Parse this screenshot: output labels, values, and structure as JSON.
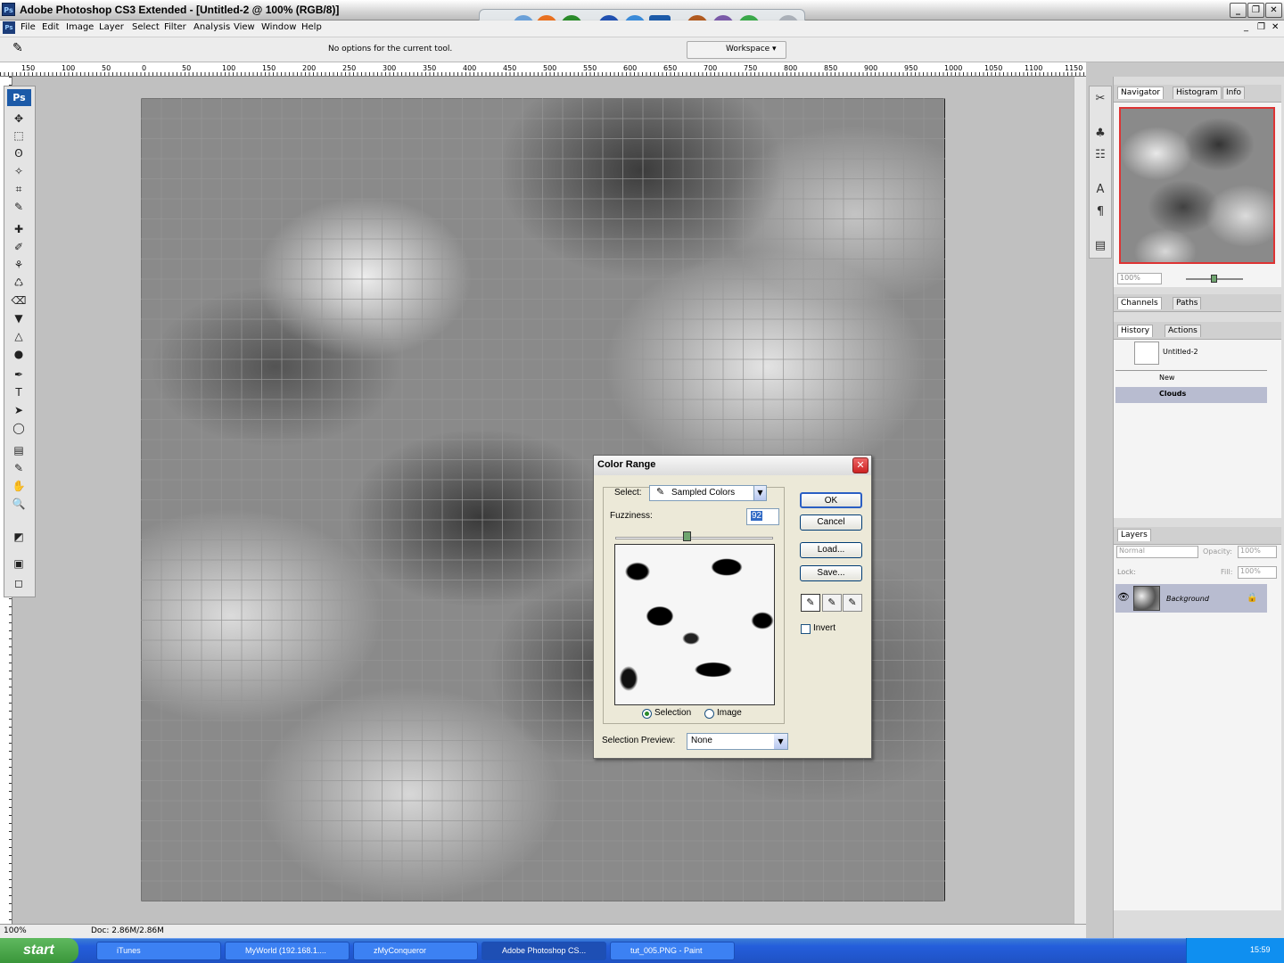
{
  "window": {
    "app_icon": "Ps",
    "title": "Adobe Photoshop CS3 Extended - [Untitled-2 @ 100% (RGB/8)]",
    "controls": [
      "_",
      "❐",
      "✕"
    ]
  },
  "quick_launch": {
    "icons": [
      "E",
      "E",
      "❖",
      "◉",
      "✚",
      "◎",
      "♫",
      "Ps",
      "CTV",
      "▦",
      "◆",
      "⟲"
    ]
  },
  "menu": {
    "app_icon": "Ps",
    "items": [
      "File",
      "Edit",
      "Image",
      "Layer",
      "Select",
      "Filter",
      "Analysis",
      "View",
      "Window",
      "Help"
    ],
    "doc_controls": [
      "_",
      "❐",
      "✕"
    ]
  },
  "options_bar": {
    "tool_icon": "✎",
    "message": "No options for the current tool.",
    "workspace_label": "Workspace ▾"
  },
  "ruler": {
    "top_labels": [
      "150",
      "100",
      "50",
      "0",
      "50",
      "100",
      "150",
      "200",
      "250",
      "300",
      "350",
      "400",
      "450",
      "500",
      "550",
      "600",
      "650",
      "700",
      "750",
      "800",
      "850",
      "900",
      "950",
      "1000",
      "1050",
      "1100",
      "1150"
    ]
  },
  "toolbox": {
    "logo": "Ps",
    "tools": [
      "✥",
      "⬚",
      "ʘ",
      "✧",
      "⌗",
      "✎",
      "✚",
      "✐",
      "⚘",
      "♺",
      "⌫",
      "▼",
      "△",
      "●",
      "✒",
      "T",
      "➤",
      "◯",
      "▤",
      "✎",
      "✋",
      "🔍",
      "◩",
      "▣",
      "◻",
      "◫"
    ]
  },
  "status_bar": {
    "zoom": "100%",
    "doc": "Doc: 2.86M/2.86M"
  },
  "panels": {
    "navigator": {
      "tabs": [
        "Navigator",
        "Histogram",
        "Info"
      ],
      "zoom": "100%"
    },
    "channels": {
      "tabs": [
        "Channels",
        "Paths"
      ]
    },
    "history": {
      "tabs": [
        "History",
        "Actions"
      ],
      "snapshot": "Untitled-2",
      "states": [
        "New",
        "Clouds"
      ]
    },
    "layers": {
      "tabs": [
        "Layers"
      ],
      "blend_mode": "Normal",
      "opacity_label": "Opacity:",
      "opacity": "100%",
      "lock_label": "Lock:",
      "fill_label": "Fill:",
      "fill": "100%",
      "layer_name": "Background"
    },
    "dock_icons": [
      "✂",
      "♣",
      "☷",
      "A",
      "¶",
      "▤"
    ]
  },
  "dialog": {
    "title": "Color Range",
    "select_label": "Select:",
    "select_value": "Sampled Colors",
    "fuzziness_label": "Fuzziness:",
    "fuzziness_value": "92",
    "fuzziness_slider": 0.46,
    "buttons": [
      "OK",
      "Cancel",
      "Load...",
      "Save..."
    ],
    "invert_label": "Invert",
    "radio_selection": "Selection",
    "radio_image": "Image",
    "preview_label": "Selection Preview:",
    "preview_value": "None"
  },
  "taskbar": {
    "start": "start",
    "tasks": [
      "iTunes",
      "MyWorld (192.168.1....",
      "zMyConqueror",
      "Adobe Photoshop CS...",
      "tut_005.PNG - Paint"
    ],
    "clock": "15:59"
  }
}
